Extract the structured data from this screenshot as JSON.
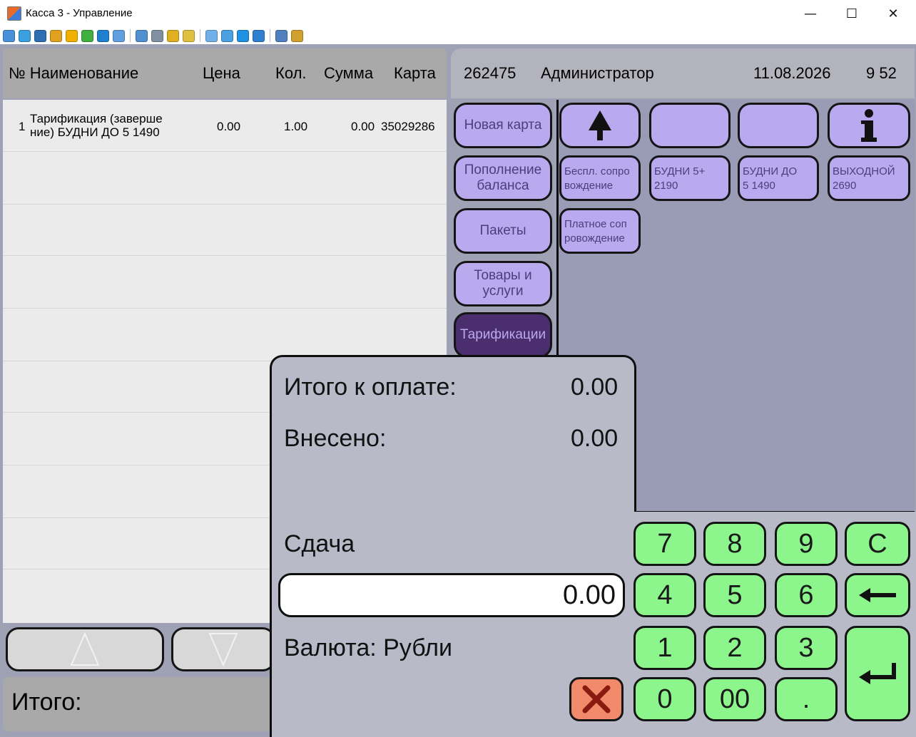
{
  "window": {
    "title": "Касса 3 - Управление",
    "controls": {
      "minimize": "—",
      "maximize": "☐",
      "close": "✕"
    }
  },
  "toolbar": {
    "icons": [
      "monitor-icon",
      "screen-icon",
      "terminal-icon",
      "transfer-icon",
      "clock-icon",
      "chat-icon",
      "phone-icon",
      "message-icon",
      "upload-icon",
      "network-icon",
      "lock-icon",
      "unlock-icon",
      "window-icon",
      "fullscreen-icon",
      "square-icon",
      "settings-icon",
      "copy-icon",
      "tools-icon"
    ]
  },
  "receipt": {
    "headers": {
      "name": "№ Наименование",
      "price": "Цена",
      "qty": "Кол.",
      "sum": "Сумма",
      "card": "Карта"
    },
    "rows": [
      {
        "num": "1",
        "name_line1": "Тарификация (заверше",
        "name_line2": "ние) БУДНИ ДО 5 1490",
        "price": "0.00",
        "qty": "1.00",
        "sum": "0.00",
        "card": "35029286"
      }
    ],
    "total_label": "Итого:"
  },
  "info": {
    "id": "262475",
    "user": "Администратор",
    "date": "11.08.2026",
    "time": "9 52"
  },
  "categories": [
    {
      "label": "Новая карта"
    },
    {
      "label": "Пополнение баланса"
    },
    {
      "label": "Пакеты"
    },
    {
      "label": "Товары и услуги"
    },
    {
      "label": "Тарификации"
    }
  ],
  "tariffs": [
    {
      "line1": "Беспл. сопро",
      "line2": "вождение"
    },
    {
      "line1": "БУДНИ 5+",
      "line2": "2190"
    },
    {
      "line1": "БУДНИ ДО",
      "line2": "5 1490"
    },
    {
      "line1": "ВЫХОДНОЙ",
      "line2": "2690"
    },
    {
      "line1": "Платное соп",
      "line2": "ровождение"
    }
  ],
  "payment": {
    "total_label": "Итого к оплате:",
    "total_value": "0.00",
    "paid_label": "Внесено:",
    "paid_value": "0.00",
    "change_label": "Сдача",
    "change_value": "0.00",
    "currency_label": "Валюта: Рубли"
  },
  "keypad": {
    "k7": "7",
    "k8": "8",
    "k9": "9",
    "clear": "C",
    "k4": "4",
    "k5": "5",
    "k6": "6",
    "k1": "1",
    "k2": "2",
    "k3": "3",
    "k0": "0",
    "k00": "00",
    "dot": "."
  },
  "colors": {
    "background": "#9fa2b4",
    "category_button": "#b9a9ee",
    "category_active": "#4b2e6e",
    "key_green": "#8cf58c",
    "cancel_red": "#f08a6a"
  }
}
